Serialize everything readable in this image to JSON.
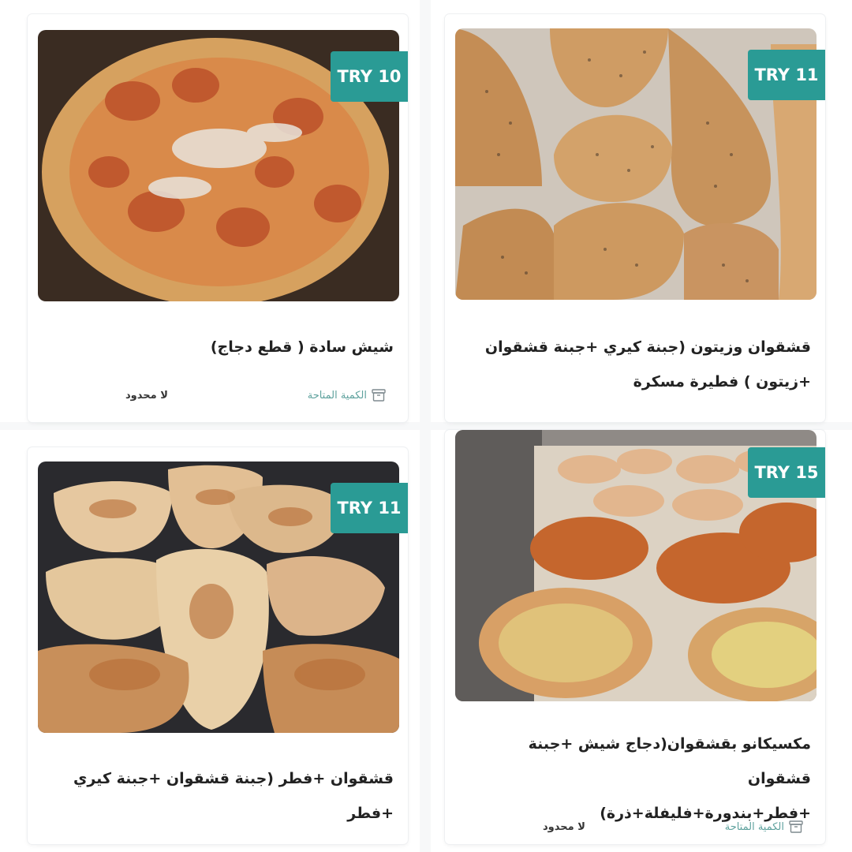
{
  "currency_prefix": "TRY",
  "accent_color": "#2a9b95",
  "products": [
    {
      "title_line1": "قشقوان وزيتون (جبنة كيري +جبنة قشقوان",
      "title_line2": "+زيتون ) فطيرة مسكرة",
      "price": "TRY 11",
      "image": "sesame-pastries-photo"
    },
    {
      "title_line1": "شيش سادة ( قطع دجاج)",
      "title_line2": "",
      "price": "TRY 10",
      "image": "chicken-pizza-photo",
      "stock_label": "الكمية المتاحة",
      "stock_value": "لا محدود"
    },
    {
      "title_line1": "مكسيكانو بقشقوان(دجاج شيش +جبنة قشقوان",
      "title_line2": "+فطر+بندورة+فليفلة+ذرة)",
      "price": "TRY 15",
      "image": "assorted-pies-photo",
      "stock_label": "الكمية المتاحة",
      "stock_value": "لا محدود"
    },
    {
      "title_line1": "قشقوان +فطر (جبنة قشقوان +جبنة كيري",
      "title_line2": "+فطر",
      "price": "TRY 11",
      "image": "folded-pastries-photo"
    }
  ]
}
